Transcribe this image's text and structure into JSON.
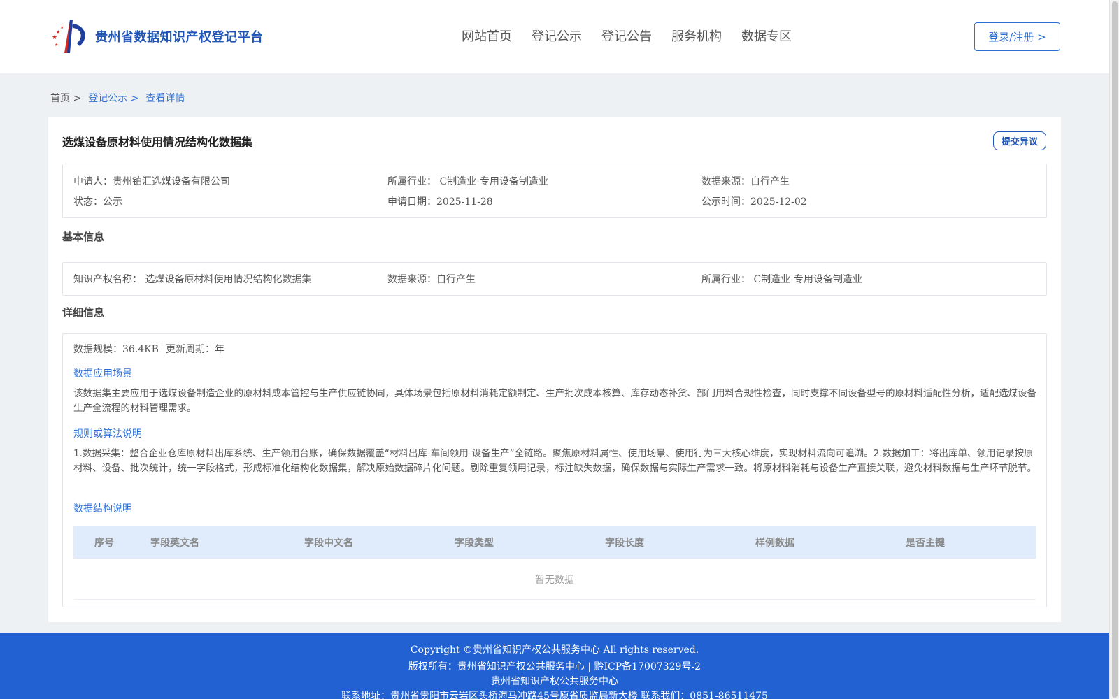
{
  "header": {
    "logo_title": "贵州省数据知识产权登记平台",
    "nav": [
      "网站首页",
      "登记公示",
      "登记公告",
      "服务机构",
      "数据专区"
    ],
    "login_label": "登录/注册 >"
  },
  "breadcrumb": {
    "home": "首页 >",
    "list": "登记公示 >",
    "current": "查看详情"
  },
  "record": {
    "title": "选煤设备原材料使用情况结构化数据集",
    "objection_label": "提交异议",
    "meta": {
      "applicant_label": "申请人：",
      "applicant": "贵州铂汇选煤设备有限公司",
      "industry_label": "所属行业：",
      "industry": "C制造业-专用设备制造业",
      "source_label": "数据来源：",
      "source": "自行产生",
      "status_label": "状态：",
      "status": "公示",
      "apply_date_label": "申请日期：",
      "apply_date": "2025-11-28",
      "publish_date_label": "公示时间：",
      "publish_date": "2025-12-02"
    }
  },
  "basic": {
    "title": "基本信息",
    "ip_name_label": "知识产权名称：",
    "ip_name": "选煤设备原材料使用情况结构化数据集",
    "source_label": "数据来源：",
    "source": "自行产生",
    "industry_label": "所属行业：",
    "industry": "C制造业-专用设备制造业"
  },
  "detail": {
    "title": "详细信息",
    "scale_label": "数据规模：",
    "scale": "36.4KB",
    "cycle_label": "更新周期：",
    "cycle": "年",
    "scenario_title": "数据应用场景",
    "scenario_text": "该数据集主要应用于选煤设备制造企业的原材料成本管控与生产供应链协同，具体场景包括原材料消耗定额制定、生产批次成本核算、库存动态补货、部门用料合规性检查，同时支撑不同设备型号的原材料适配性分析，适配选煤设备生产全流程的材料管理需求。",
    "rules_title": "规则或算法说明",
    "rules_text": "1.数据采集：整合企业仓库原材料出库系统、生产领用台账，确保数据覆盖“材料出库-车间领用-设备生产”全链路。聚焦原材料属性、使用场景、使用行为三大核心维度，实现材料流向可追溯。2.数据加工：将出库单、领用记录按原材料、设备、批次统计，统一字段格式，形成标准化结构化数据集，解决原始数据碎片化问题。剔除重复领用记录，标注缺失数据，确保数据与实际生产需求一致。将原材料消耗与设备生产直接关联，避免材料数据与生产环节脱节。",
    "structure_title": "数据结构说明",
    "table_headers": [
      "序号",
      "字段英文名",
      "字段中文名",
      "字段类型",
      "字段长度",
      "样例数据",
      "是否主键"
    ],
    "empty_text": "暂无数据"
  },
  "footer": {
    "copyright": "Copyright ©贵州省知识产权公共服务中心 All rights reserved.",
    "owner": "版权所有：贵州省知识产权公共服务中心 | 黔ICP备17007329号-2",
    "org": "贵州省知识产权公共服务中心",
    "address": "联系地址：贵州省贵阳市云岩区头桥海马冲路45号原省质监局新大楼 联系我们：0851-86511475"
  },
  "colors": {
    "brand": "#1f55b6",
    "link": "#2e6fd4",
    "footer_bg": "#2261d2",
    "table_head_bg": "#e0ecfb"
  }
}
